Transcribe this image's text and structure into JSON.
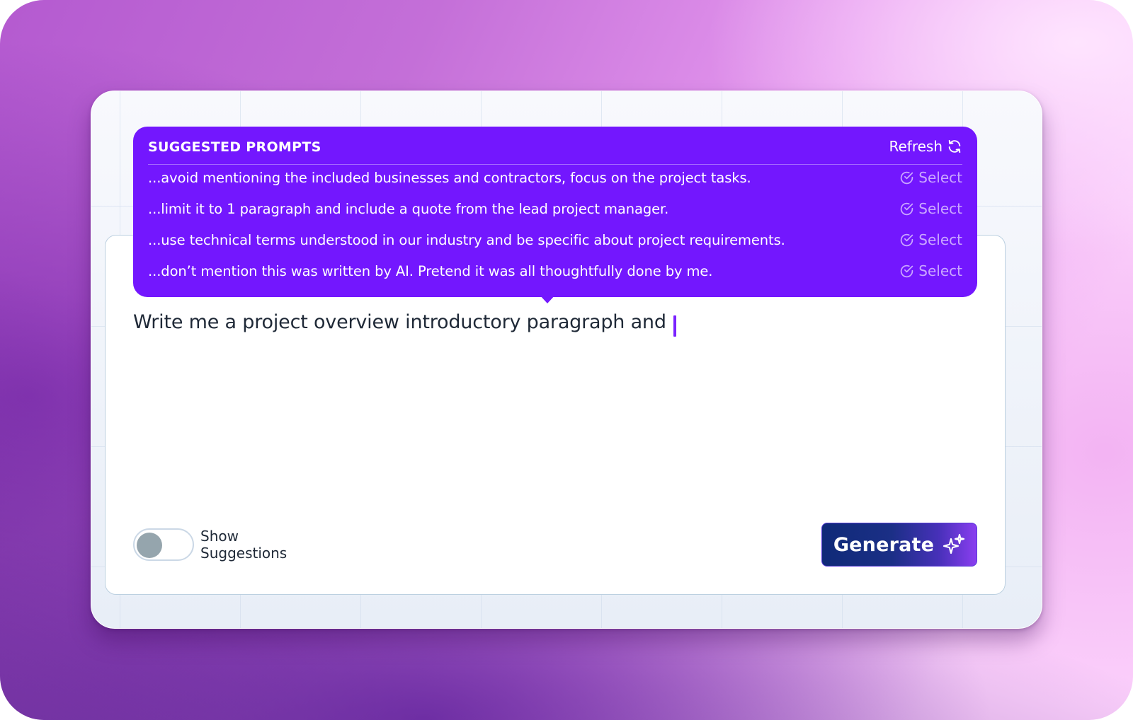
{
  "suggested_prompts": {
    "title": "SUGGESTED PROMPTS",
    "refresh_label": "Refresh",
    "refresh_icon": "refresh-icon",
    "items": [
      {
        "text": "...avoid mentioning the included businesses and contractors, focus on the project tasks.",
        "action_label": "Select"
      },
      {
        "text": "...limit it to 1 paragraph and include a quote from the lead project manager.",
        "action_label": "Select"
      },
      {
        "text": "...use technical terms understood in our industry and be specific about project requirements.",
        "action_label": "Select"
      },
      {
        "text": "...don’t mention this was written by AI. Pretend it was all thoughtfully done by me.",
        "action_label": "Select"
      }
    ],
    "select_icon": "check-circle-icon"
  },
  "editor": {
    "value": "Write me a project overview introductory paragraph and"
  },
  "footer": {
    "toggle_label": "Show Suggestions",
    "toggle_on": false,
    "generate_label": "Generate",
    "generate_icon": "sparkles-icon"
  },
  "colors": {
    "accent": "#7317fe",
    "caret": "#7a22ff",
    "button_dark": "#0f2a78",
    "button_light": "#8a3ef0"
  }
}
